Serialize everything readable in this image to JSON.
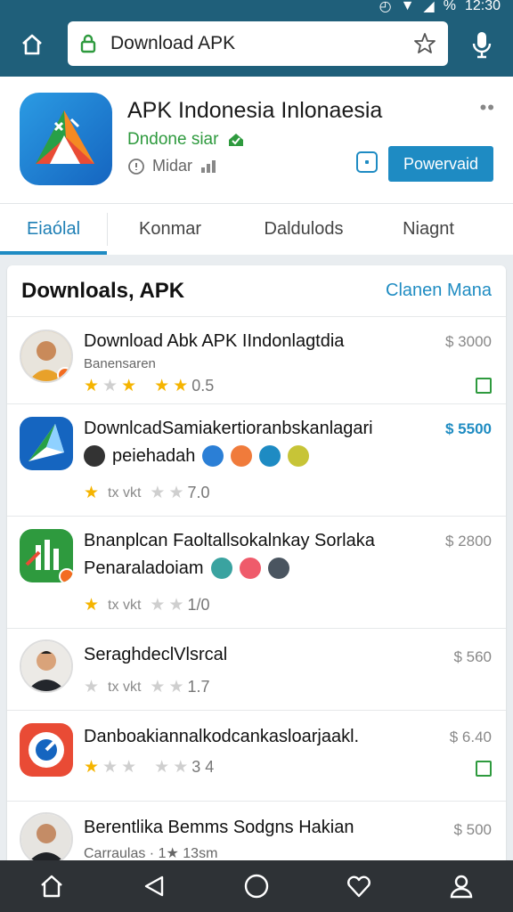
{
  "status": {
    "time": "12:30",
    "battery": "%"
  },
  "browser": {
    "url": "Download APK"
  },
  "app": {
    "title": "APK Indonesia Inlonaesia",
    "developer": "Dndone siar",
    "meta": "Midar",
    "download_label": "Powervaid"
  },
  "tabs": [
    "Eiaólal",
    "Konmar",
    "Daldulods",
    "Niagnt"
  ],
  "list": {
    "heading": "Downloals, APK",
    "action": "Clanen Mana",
    "items": [
      {
        "title": "Download Abk APK IIndonlagtdia",
        "sub": "Banensaren",
        "rating": "0.5",
        "price": "$ 3000",
        "stars": [
          1,
          0,
          1,
          0,
          1,
          1
        ]
      },
      {
        "title": "DownlcadSamiakertioranbskanlagari",
        "line2": "peiehadah",
        "rating": "7.0",
        "price": "$ 5500",
        "rating_label": "tx vkt"
      },
      {
        "title": "Bnanplcan Faoltallsokalnkay Sorlaka",
        "line2": "Penaraladoiam",
        "rating": "1/0",
        "price": "$ 2800",
        "rating_label": "tx vkt"
      },
      {
        "title": "SeraghdeclVlsrcal",
        "rating": "1.7",
        "price": "$ 560",
        "rating_label": "tx vkt"
      },
      {
        "title": "Danboakiannalkodcankasloarjaakl.",
        "rating": "3 4",
        "price": "$ 6.40"
      },
      {
        "title": "Berentlika Bemms Sodgns Hakian",
        "sub": "Carraulas · 1★ 13sm",
        "price": "$ 500"
      }
    ]
  },
  "nav": [
    "home-icon",
    "back-icon",
    "circle-home-icon",
    "heart-icon",
    "profile-icon"
  ]
}
